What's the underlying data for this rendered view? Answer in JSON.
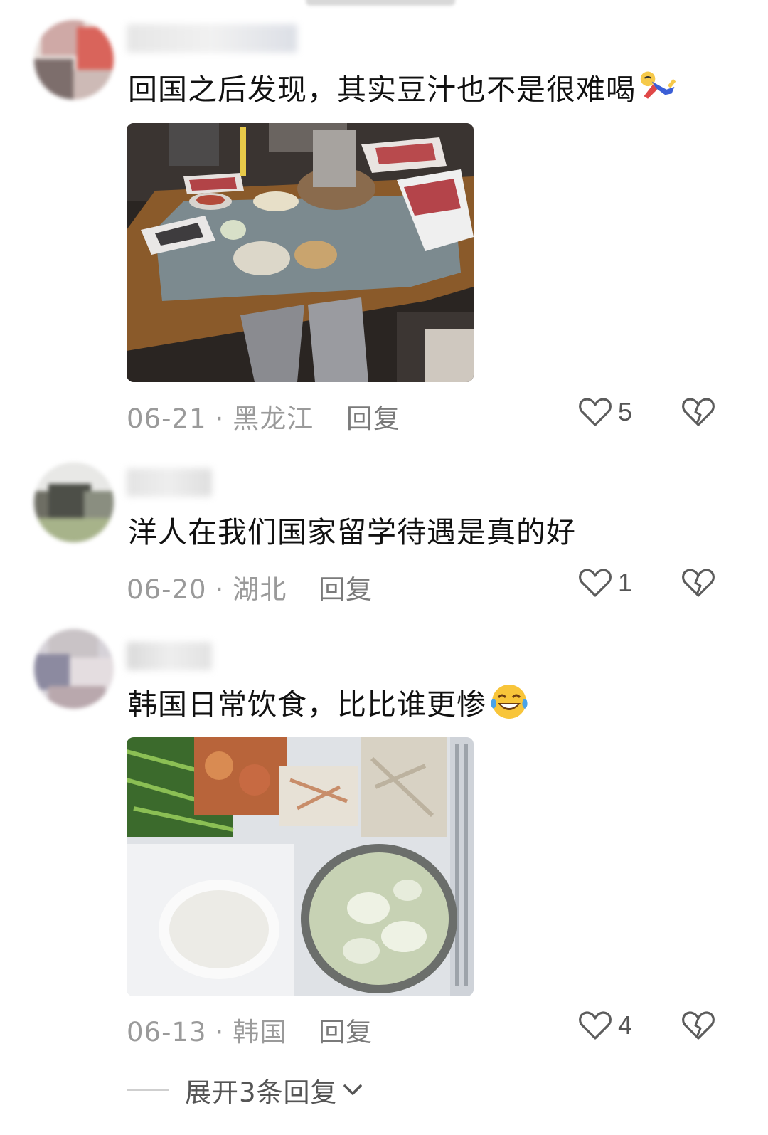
{
  "comments": [
    {
      "text": "回国之后发现，其实豆汁也不是很难喝",
      "emoji": "person-falling-emoji",
      "has_photo": true,
      "photo_subject": "hotpot-table-photo",
      "date": "06-21",
      "separator": "·",
      "region": "黑龙江",
      "reply_label": "回复",
      "likes": "5"
    },
    {
      "text": "洋人在我们国家留学待遇是真的好",
      "has_photo": false,
      "date": "06-20",
      "separator": "·",
      "region": "湖北",
      "reply_label": "回复",
      "likes": "1"
    },
    {
      "text": "韩国日常饮食，比比谁更惨",
      "emoji": "laughing-crying-emoji",
      "has_photo": true,
      "photo_subject": "school-lunch-tray-photo",
      "date": "06-13",
      "separator": "·",
      "region": "韩国",
      "reply_label": "回复",
      "likes": "4"
    }
  ],
  "expand_replies_label": "展开3条回复",
  "colors": {
    "text": "#111111",
    "meta": "#9a9a9a",
    "icon": "#5c5c5c"
  }
}
